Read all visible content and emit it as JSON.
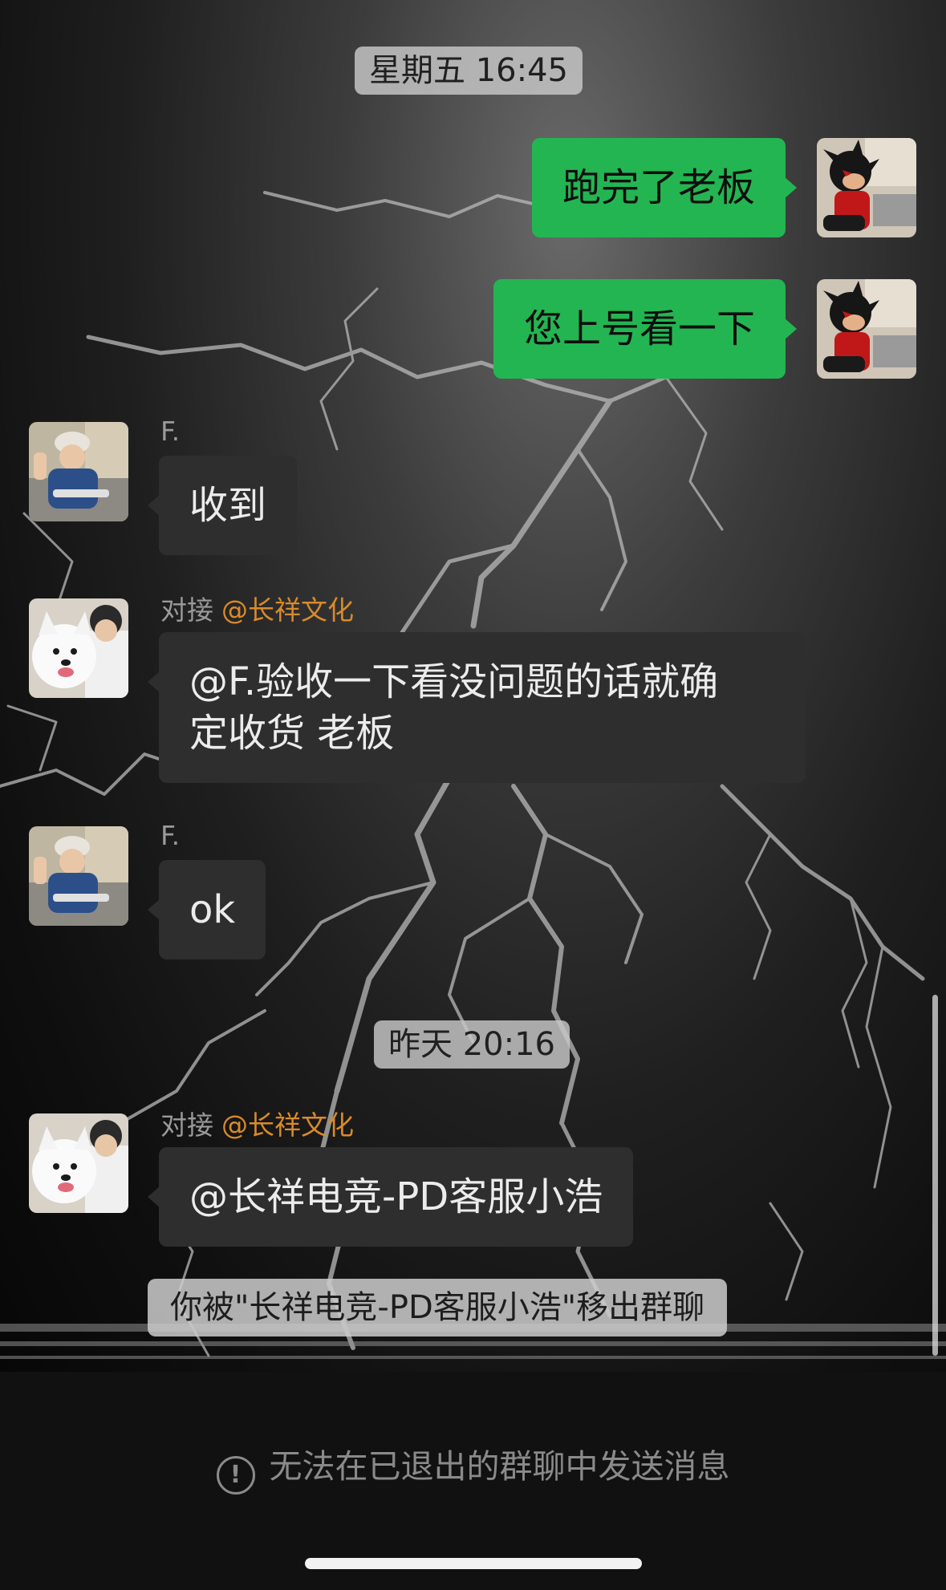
{
  "messages": {
    "time1": "星期五 16:45",
    "mine1": "跑完了老板",
    "mine2": "您上号看一下",
    "sender_f": "F.",
    "msg_received": "收到",
    "sender_duijie": "对接",
    "sender_duijie_tag": "@长祥文化",
    "msg_duijie_line1": "@F.验收一下看没问题的话就确",
    "msg_duijie_line2": "定收货 老板",
    "msg_ok": "ok",
    "time2": "昨天 20:16",
    "msg_mention": "@长祥电竞-PD客服小浩",
    "system_removed": "你被\"长祥电竞-PD客服小浩\"移出群聊"
  },
  "footer": {
    "notice_icon": "!",
    "notice_text": "无法在已退出的群聊中发送消息"
  },
  "colors": {
    "my_bubble": "#23b552",
    "their_bubble": "#2e2e2e",
    "tag_orange": "#d98a2b"
  },
  "icons": {
    "warning": "exclamation-circle-icon"
  }
}
